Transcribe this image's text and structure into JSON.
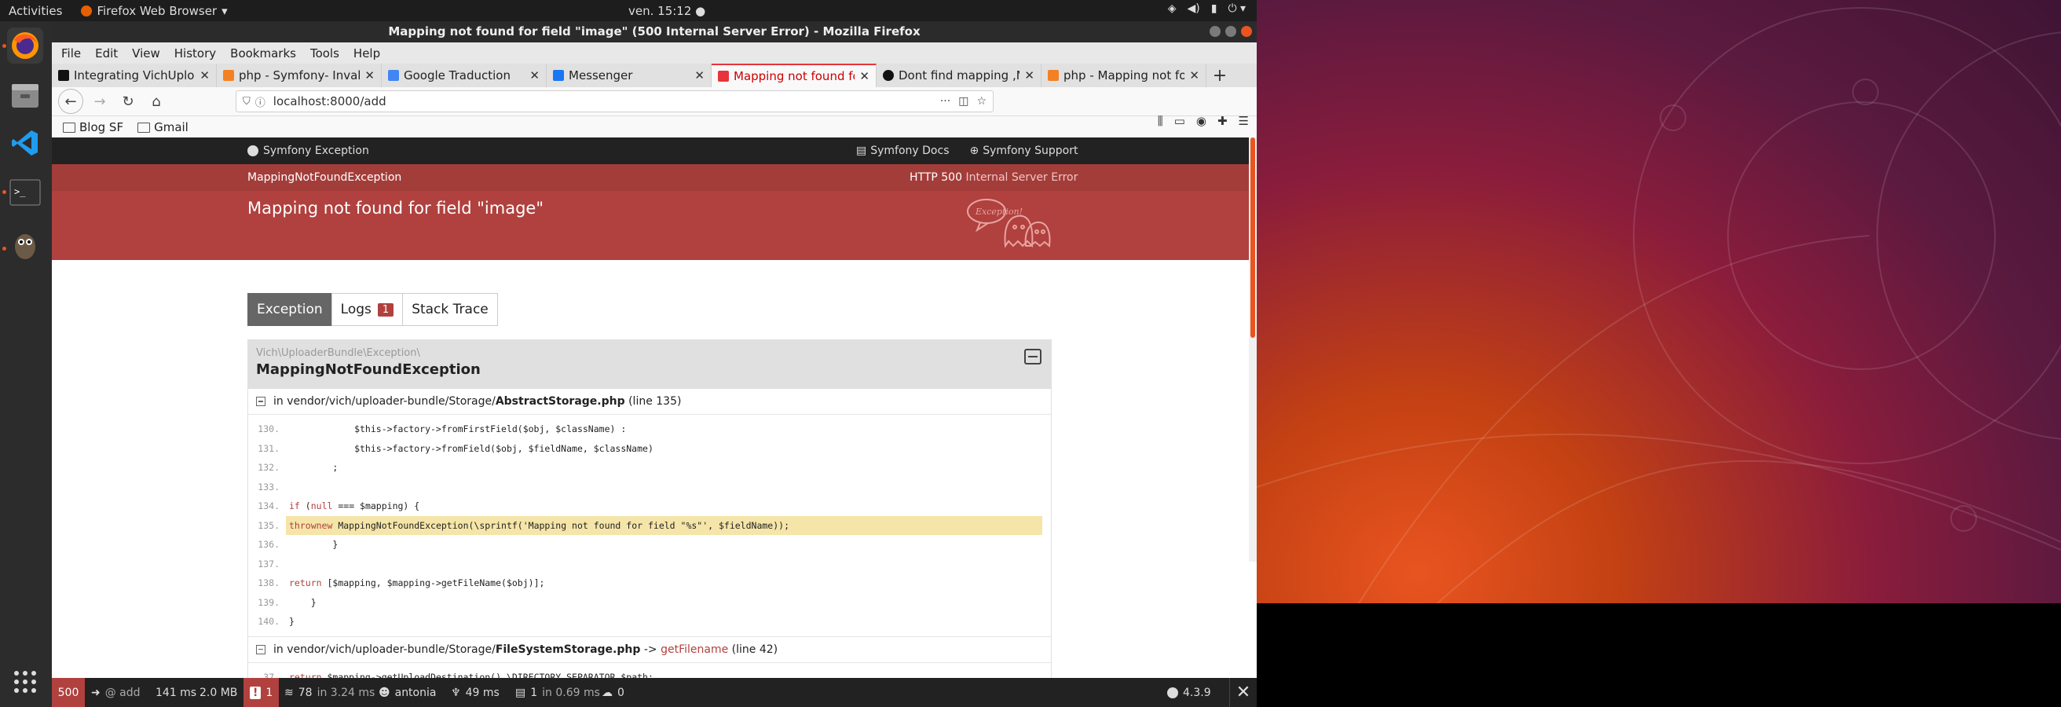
{
  "topbar": {
    "activities": "Activities",
    "app_menu": "Firefox Web Browser",
    "clock": "ven. 15:12"
  },
  "dock": {
    "items": [
      "firefox-icon",
      "files-icon",
      "vscode-icon",
      "terminal-icon",
      "gimp-icon",
      "app-grid-icon"
    ]
  },
  "window": {
    "title": "Mapping not found for field \"image\" (500 Internal Server Error) - Mozilla Firefox"
  },
  "menubar": [
    "File",
    "Edit",
    "View",
    "History",
    "Bookmarks",
    "Tools",
    "Help"
  ],
  "tabs": [
    {
      "title": "Integrating VichUpload",
      "favicon_color": "#111111",
      "active": false
    },
    {
      "title": "php - Symfony- Invalid",
      "favicon_color": "#f48024",
      "active": false
    },
    {
      "title": "Google Traduction",
      "favicon_color": "#4285f4",
      "active": false
    },
    {
      "title": "Messenger",
      "favicon_color": "#1877f2",
      "active": false
    },
    {
      "title": "Mapping not found for",
      "favicon_color": "#e8343b",
      "active": true
    },
    {
      "title": "Dont find mapping ,Ma",
      "favicon_color": "#111111",
      "active": false
    },
    {
      "title": "php - Mapping not foun",
      "favicon_color": "#f48024",
      "active": false
    }
  ],
  "urlbar": {
    "url": "localhost:8000/add",
    "dots": "···"
  },
  "bookmarks": [
    "Blog SF",
    "Gmail"
  ],
  "symfony": {
    "header_brand": "Symfony Exception",
    "docs": "Symfony Docs",
    "support": "Symfony Support",
    "exception_class": "MappingNotFoundException",
    "http_code": "HTTP 500",
    "http_text": "Internal Server Error",
    "message": "Mapping not found for field \"image\"",
    "ghost_label": "Exception!",
    "tabs": {
      "exception": "Exception",
      "logs": "Logs",
      "logs_count": "1",
      "stack": "Stack Trace"
    },
    "namespace": "Vich\\UploaderBundle\\Exception\\",
    "name": "MappingNotFoundException",
    "trace1": {
      "prefix": "in vendor/vich/uploader-bundle/Storage/",
      "file": "AbstractStorage.php",
      "suffix": "(line 135)"
    },
    "code1": [
      {
        "ln": "130.",
        "src": "            $this->factory->fromFirstField($obj, $className) :",
        "hl": false
      },
      {
        "ln": "131.",
        "src": "            $this->factory->fromField($obj, $fieldName, $className)",
        "hl": false
      },
      {
        "ln": "132.",
        "src": "        ;",
        "hl": false
      },
      {
        "ln": "133.",
        "src": "",
        "hl": false
      },
      {
        "ln": "134.",
        "src": "        if (null === $mapping) {",
        "hl": false
      },
      {
        "ln": "135.",
        "src": "            throw new MappingNotFoundException(\\sprintf('Mapping not found for field \"%s\"', $fieldName));",
        "hl": true
      },
      {
        "ln": "136.",
        "src": "        }",
        "hl": false
      },
      {
        "ln": "137.",
        "src": "",
        "hl": false
      },
      {
        "ln": "138.",
        "src": "        return [$mapping, $mapping->getFileName($obj)];",
        "hl": false
      },
      {
        "ln": "139.",
        "src": "    }",
        "hl": false
      },
      {
        "ln": "140.",
        "src": "}",
        "hl": false
      }
    ],
    "trace2": {
      "prefix": "in vendor/vich/uploader-bundle/Storage/",
      "file": "FileSystemStorage.php",
      "arrow": " -> ",
      "fn": "getFilename",
      "suffix": "(line 42)"
    },
    "code2": [
      {
        "ln": "37.",
        "src": "        return $mapping->getUploadDestination().\\DIRECTORY_SEPARATOR.$path;",
        "hl": false
      }
    ]
  },
  "toolbar": {
    "status": "500",
    "route": "@ add",
    "time": "141 ms",
    "memory": "2.0 MB",
    "errors": "1",
    "db": "78",
    "db_time": "in 3.24 ms",
    "user": "antonia",
    "twig": "49 ms",
    "cache": "1",
    "cache_time": "in 0.69 ms",
    "mailer": "0",
    "version": "4.3.9"
  },
  "colors": {
    "symfony_red": "#b0413e",
    "ubuntu_orange": "#e95420",
    "code_highlight": "#f5e5a8"
  }
}
